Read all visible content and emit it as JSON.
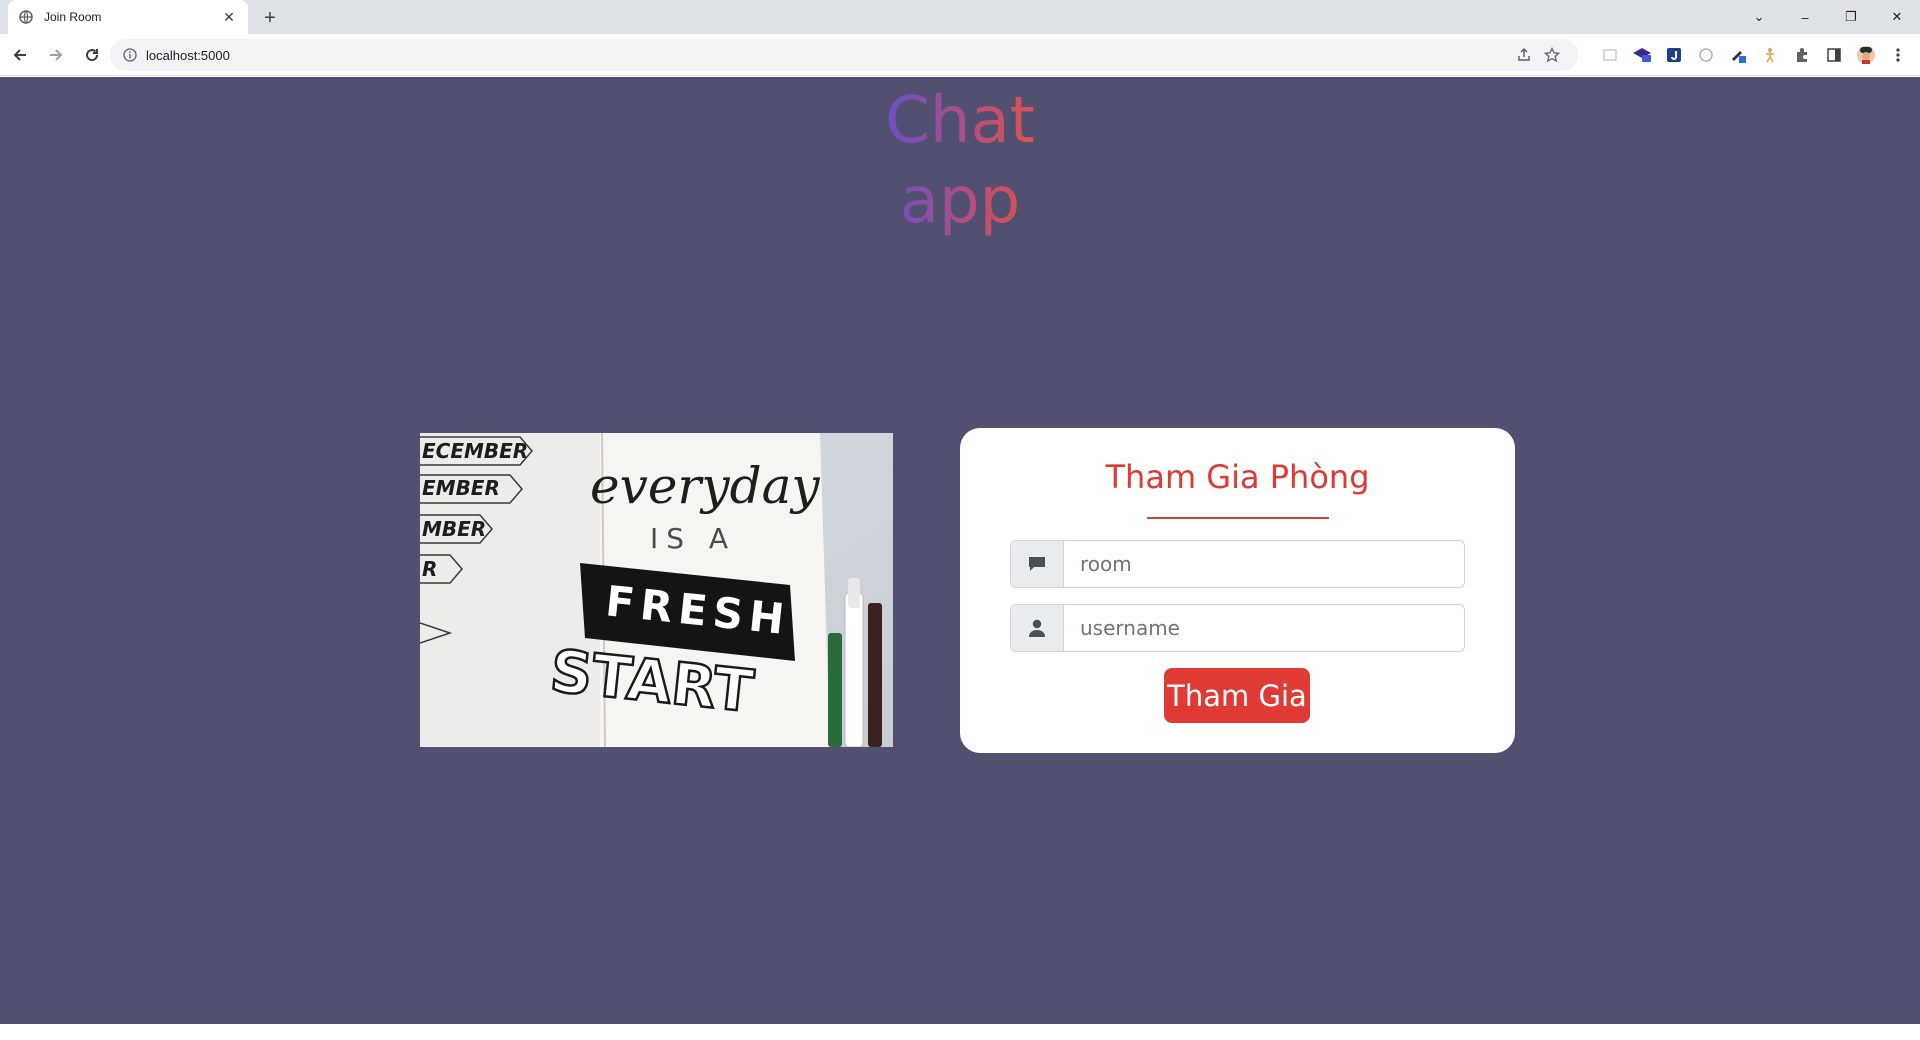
{
  "browser": {
    "tab_title": "Join Room",
    "tab_close": "✕",
    "new_tab": "+",
    "url": "localhost:5000",
    "window_controls": {
      "tabsearch": "⌄",
      "minimize": "–",
      "restore": "❐",
      "close": "✕"
    }
  },
  "page": {
    "app_title": "Chat app",
    "hero_image": {
      "months": [
        "ECEMBER",
        "EMBER",
        "MBER",
        "R"
      ],
      "line1": "everyday",
      "line2": "IS A",
      "line3": "FRESH",
      "line4": "START"
    },
    "card": {
      "title": "Tham Gia Phòng",
      "room_placeholder": "room",
      "username_placeholder": "username",
      "join_label": "Tham Gia"
    }
  },
  "colors": {
    "page_bg": "#515070",
    "accent": "#e03a35",
    "card_bg": "#ffffff",
    "title_gradient_start": "#5b4ad8",
    "title_gradient_end": "#f05b32"
  }
}
